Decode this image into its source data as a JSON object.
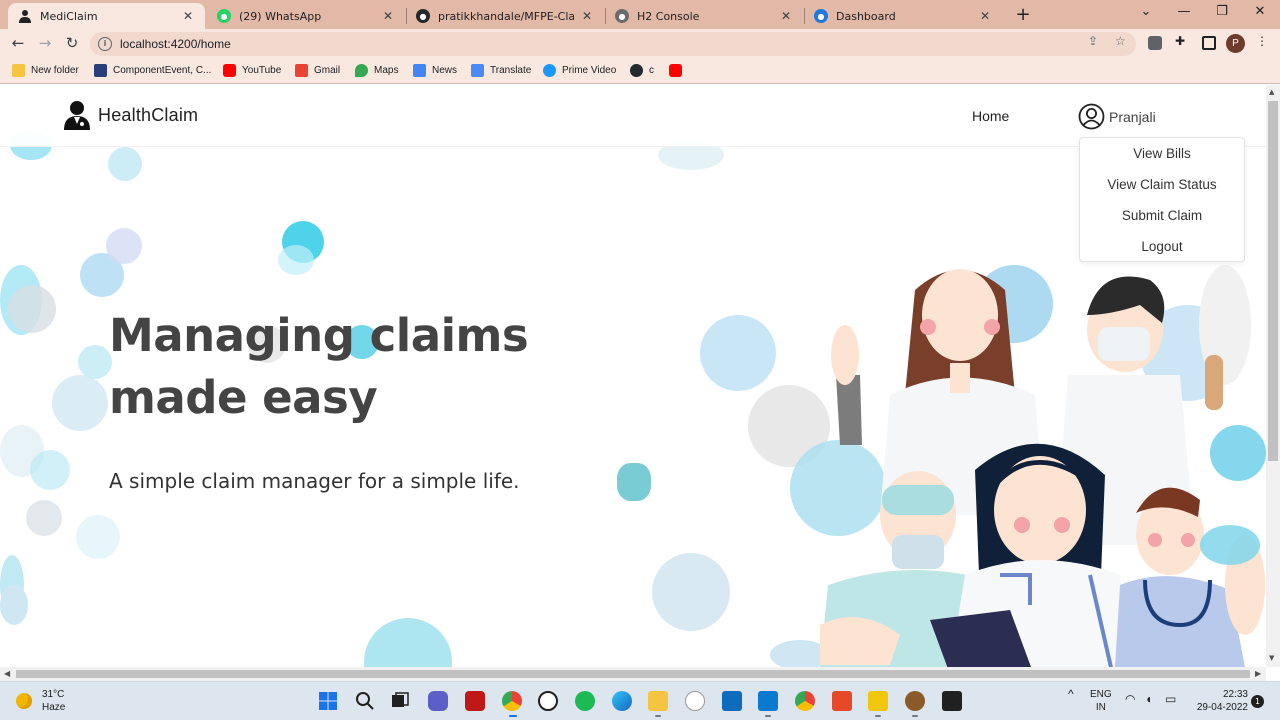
{
  "browser": {
    "tabs": [
      {
        "title": "MediClaim",
        "active": true,
        "icon": "mediclaim-favicon"
      },
      {
        "title": "(29) WhatsApp",
        "active": false,
        "icon": "whatsapp-favicon"
      },
      {
        "title": "pratikkhandale/MFPE-Claim-Ma",
        "active": false,
        "icon": "github-favicon"
      },
      {
        "title": "H2 Console",
        "active": false,
        "icon": "h2-favicon"
      },
      {
        "title": "Dashboard",
        "active": false,
        "icon": "edge-favicon"
      }
    ],
    "url": "localhost:4200/home",
    "profile_initial": "P",
    "bookmarks": [
      {
        "label": "New folder",
        "icon": "folder-icon"
      },
      {
        "label": "ComponentEvent, C...",
        "icon": "java-doc-icon"
      },
      {
        "label": "YouTube",
        "icon": "youtube-icon"
      },
      {
        "label": "Gmail",
        "icon": "gmail-icon"
      },
      {
        "label": "Maps",
        "icon": "maps-icon"
      },
      {
        "label": "News",
        "icon": "news-icon"
      },
      {
        "label": "Translate",
        "icon": "translate-icon"
      },
      {
        "label": "Prime Video",
        "icon": "prime-video-icon"
      },
      {
        "label": "c",
        "icon": "github-icon"
      },
      {
        "label": "",
        "icon": "youtube-icon"
      }
    ]
  },
  "site": {
    "brand": "HealthClaim",
    "nav_home": "Home",
    "user_name": "Pranjali",
    "dropdown": [
      "View Bills",
      "View Claim Status",
      "Submit Claim",
      "Logout"
    ],
    "hero_title_line1": "Managing claims",
    "hero_title_line2": "made easy",
    "hero_subtitle": "A simple claim manager for a simple life."
  },
  "taskbar": {
    "temperature": "31°C",
    "weather": "Haze",
    "lang_top": "ENG",
    "lang_bottom": "IN",
    "time": "22:33",
    "date": "29-04-2022",
    "notifications": "1"
  },
  "colors": {
    "accent_bubble": "#4fd3ea",
    "tabbar": "#e2b8a6",
    "toolbar": "#f8e8e0",
    "text_dark": "#444444"
  }
}
